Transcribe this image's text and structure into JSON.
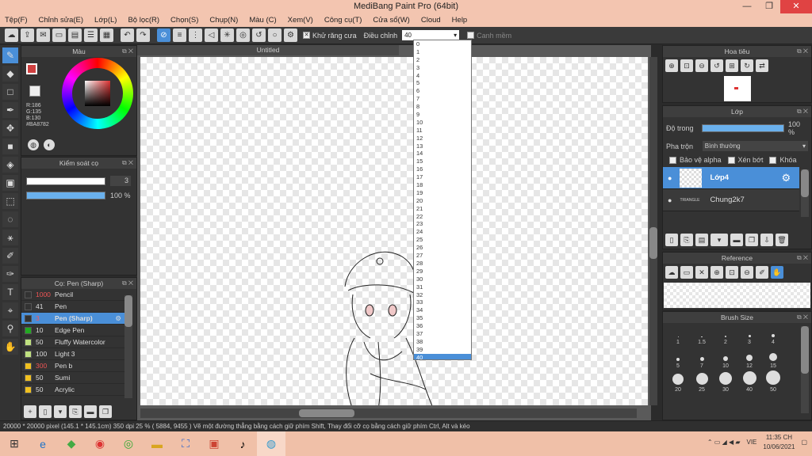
{
  "window": {
    "title": "MediBang Paint Pro (64bit)",
    "min": "—",
    "max": "❐",
    "close": "✕"
  },
  "menu": [
    "Tệp(F)",
    "Chỉnh sửa(E)",
    "Lớp(L)",
    "Bộ lọc(R)",
    "Chọn(S)",
    "Chụp(N)",
    "Màu (C)",
    "Xem(V)",
    "Công cụ(T)",
    "Cửa sổ(W)",
    "Cloud",
    "Help"
  ],
  "toolbar": {
    "antialias": "Khử răng cưa",
    "adjust": "Điều chỉnh",
    "adjust_value": "40",
    "edge": "Canh mềm"
  },
  "canvas": {
    "tab": "Untitled"
  },
  "dropdown": {
    "options": [
      "0",
      "1",
      "2",
      "3",
      "4",
      "5",
      "6",
      "7",
      "8",
      "9",
      "10",
      "11",
      "12",
      "13",
      "14",
      "15",
      "16",
      "17",
      "18",
      "19",
      "20",
      "21",
      "22",
      "23",
      "24",
      "25",
      "26",
      "27",
      "28",
      "29",
      "30",
      "31",
      "32",
      "33",
      "34",
      "35",
      "36",
      "37",
      "38",
      "39",
      "40"
    ],
    "selected": "40"
  },
  "color_panel": {
    "title": "Màu",
    "r": "R:186",
    "g": "G:135",
    "b": "B:130",
    "hex": "#BA8782",
    "fg": "#ba8782"
  },
  "brush_control": {
    "title": "Kiểm soát cọ",
    "size": "3",
    "opacity": "100 %",
    "opacity_level": 1.0
  },
  "brush_panel": {
    "title": "Cọ: Pen (Sharp)",
    "items": [
      {
        "size": "1000",
        "name": "Pencil",
        "color": "#333333"
      },
      {
        "size": "41",
        "name": "Pen",
        "color": "#333333"
      },
      {
        "size": "3",
        "name": "Pen (Sharp)",
        "color": "#333333"
      },
      {
        "size": "10",
        "name": "Edge Pen",
        "color": "#22aa22"
      },
      {
        "size": "50",
        "name": "Fluffy Watercolor",
        "color": "#bfe080"
      },
      {
        "size": "100",
        "name": "Light 3",
        "color": "#bfe080"
      },
      {
        "size": "300",
        "name": "Pen b",
        "color": "#f0c020"
      },
      {
        "size": "50",
        "name": "Sumi",
        "color": "#f0c020"
      },
      {
        "size": "50",
        "name": "Acrylic",
        "color": "#f0c020"
      }
    ]
  },
  "navigator": {
    "title": "Hoa tiêu"
  },
  "layer_panel": {
    "title": "Lớp",
    "opacity_label": "Độ trong",
    "opacity_value": "100 %",
    "opacity_level": 1.0,
    "blend_label": "Pha trộn",
    "blend_value": "Bình thường",
    "protect_alpha": "Bảo vệ alpha",
    "clipping": "Xén bớt",
    "lock": "Khóa",
    "layers": [
      {
        "name": "Lớp4"
      },
      {
        "name": "Chung2k7",
        "thumb_text": "TRIANGLE"
      }
    ]
  },
  "reference": {
    "title": "Reference"
  },
  "brush_size": {
    "title": "Brush Size",
    "row1": [
      "1",
      "1.5",
      "2",
      "3",
      "4"
    ],
    "row2": [
      "5",
      "7",
      "10",
      "12",
      "15"
    ],
    "row3": [
      "20",
      "25",
      "30",
      "40",
      "50"
    ]
  },
  "status": {
    "text": "20000 * 20000 pixel  (145.1 * 145.1cm)   350 dpi   25 %   ( 5884, 9455 )   Vẽ một đường thẳng bằng cách giữ phím Shift, Thay đổi cỡ cọ bằng cách giữ phím Ctrl, Alt và kéo"
  },
  "taskbar": {
    "lang": "VIE",
    "time": "11:35 CH",
    "date": "10/06/2021"
  }
}
